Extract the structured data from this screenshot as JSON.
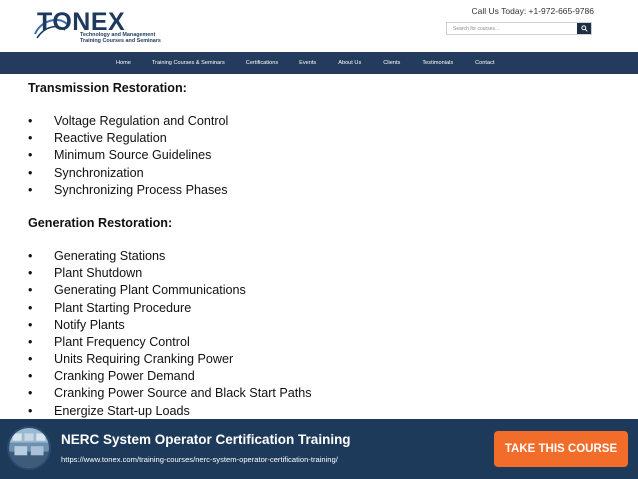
{
  "header": {
    "logo_text": "TONEX",
    "logo_tagline_lines": [
      "Technology and Management",
      "Training Courses and Seminars"
    ],
    "call_text": "Call Us Today: +1-972-665-9786",
    "search_placeholder": "Search for courses...",
    "search_icon": "search-icon"
  },
  "nav": {
    "items": [
      "Home",
      "Training Courses & Seminars",
      "Certifications",
      "Events",
      "About Us",
      "Clients",
      "Testimonials",
      "Contact"
    ]
  },
  "content": {
    "section1": {
      "heading": "Transmission Restoration:",
      "items": [
        "Voltage Regulation and Control",
        "Reactive Regulation",
        "Minimum Source Guidelines",
        "Synchronization",
        "Synchronizing Process Phases"
      ]
    },
    "section2": {
      "heading": "Generation Restoration:",
      "items": [
        "Generating Stations",
        "Plant Shutdown",
        "Generating Plant Communications",
        "Plant Starting Procedure",
        "Notify Plants",
        "Plant Frequency Control",
        "Units Requiring Cranking Power",
        "Cranking Power Demand",
        "Cranking Power Source and Black Start Paths",
        "Energize Start-up Loads"
      ]
    },
    "bullet": "•"
  },
  "banner": {
    "title": "NERC System Operator Certification Training",
    "url": "https://www.tonex.com/training-courses/nerc-system-operator-certification-training/",
    "cta_label": "TAKE THIS COURSE"
  },
  "colors": {
    "nav_bg": "#233b5d",
    "banner_bg": "#1e3a5b",
    "cta_bg": "#f26c2a",
    "logo": "#1d3a5e"
  }
}
